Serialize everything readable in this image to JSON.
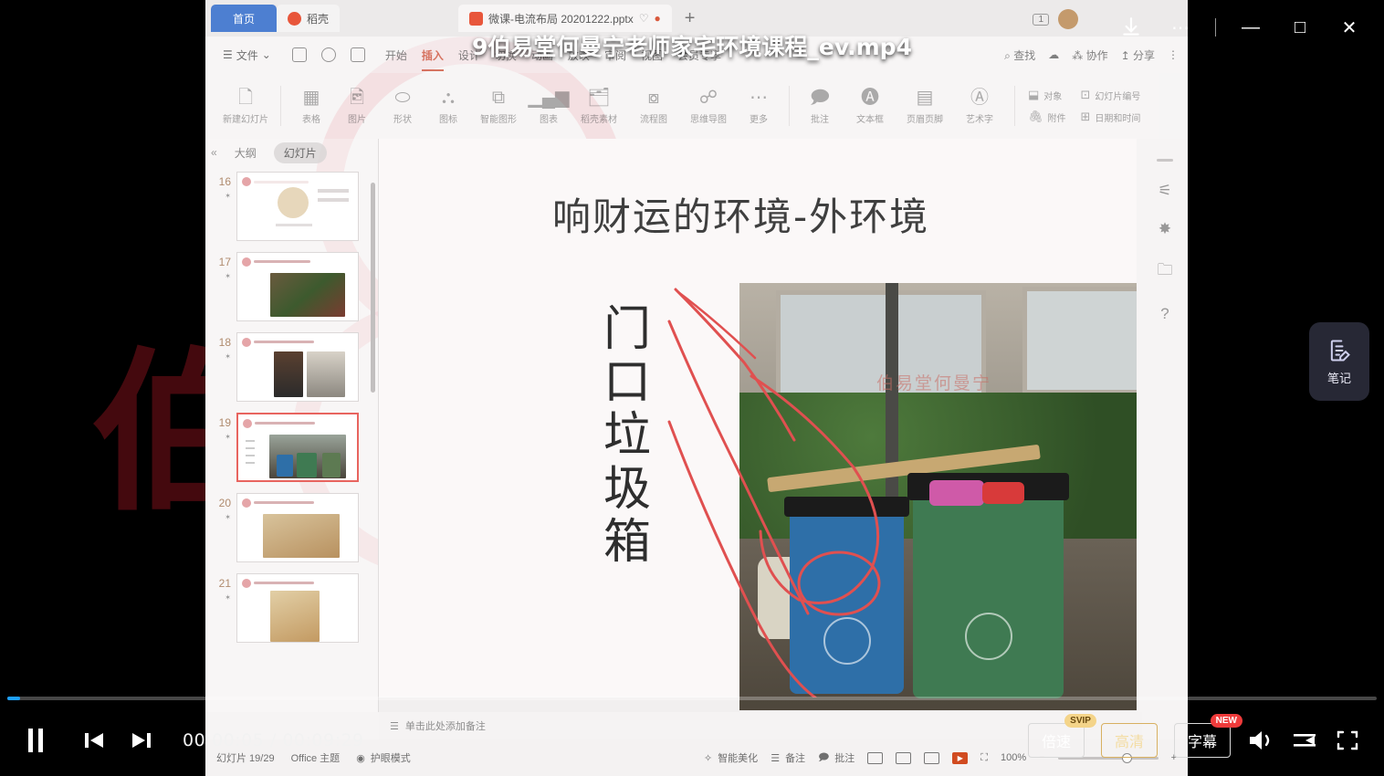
{
  "video": {
    "title": "9伯易堂何曼宁老师家宅环境课程_ev.mp4",
    "current_time": "00:00:05",
    "total_time": "00:09:29",
    "time_display": "00:00:05 / 00:09:29",
    "progress_percent": 0.9,
    "state": "playing"
  },
  "window_controls": {
    "download_icon": "download-icon",
    "more_icon": "more-horizontal-icon",
    "minimize": "—",
    "maximize": "□",
    "close": "✕"
  },
  "player_controls": {
    "pause": "pause-icon",
    "previous": "previous-icon",
    "next": "next-icon",
    "speed_label": "倍速",
    "speed_badge": "SVIP",
    "quality_label": "高清",
    "subtitle_label": "字幕",
    "subtitle_badge": "NEW",
    "volume_icon": "volume-icon",
    "playlist_icon": "playlist-icon",
    "fullscreen_icon": "fullscreen-icon"
  },
  "notes_fab": {
    "icon": "note-edit-icon",
    "label": "笔记"
  },
  "wps": {
    "tabs": [
      {
        "label": "首页",
        "icon": "home-icon",
        "active": false
      },
      {
        "label": "稻壳",
        "icon": "daoke-icon",
        "active": false
      },
      {
        "label": "微课-电流布局 20201222.pptx",
        "icon": "pptx-icon",
        "active": true
      }
    ],
    "new_tab": "+",
    "account_badge": "1",
    "menu": {
      "file_label": "文件",
      "file_chevron": "⌄",
      "quick_access": [
        "save-icon",
        "undo-icon",
        "print-icon"
      ],
      "ribbon_tabs": [
        "开始",
        "插入",
        "设计",
        "切换",
        "动画",
        "放映",
        "审阅",
        "视图",
        "会员专享"
      ],
      "ribbon_selected": "插入",
      "search_label": "查找",
      "cloud_icon": "cloud-icon",
      "collab_label": "协作",
      "share_label": "分享",
      "overflow": "⋮"
    },
    "ribbon": {
      "items": [
        {
          "label": "新建幻灯片",
          "icon": "new-slide-icon",
          "dropdown": true
        },
        {
          "label": "表格",
          "icon": "table-icon",
          "dropdown": true
        },
        {
          "label": "图片",
          "icon": "picture-icon",
          "dropdown": true
        },
        {
          "label": "形状",
          "icon": "shape-icon",
          "dropdown": true
        },
        {
          "label": "图标",
          "icon": "icon-library-icon",
          "dropdown": true
        },
        {
          "label": "智能图形",
          "icon": "smartart-icon",
          "dropdown": true
        },
        {
          "label": "图表",
          "icon": "chart-icon",
          "dropdown": true
        },
        {
          "label": "稻壳素材",
          "icon": "material-icon",
          "dropdown": false
        },
        {
          "label": "流程图",
          "icon": "flowchart-icon",
          "dropdown": true
        },
        {
          "label": "思维导图",
          "icon": "mindmap-icon",
          "dropdown": true
        },
        {
          "label": "更多",
          "icon": "more-icon",
          "dropdown": true
        },
        {
          "label": "批注",
          "icon": "comment-icon",
          "dropdown": false
        },
        {
          "label": "文本框",
          "icon": "textbox-icon",
          "dropdown": true
        },
        {
          "label": "页眉页脚",
          "icon": "header-footer-icon",
          "dropdown": false
        },
        {
          "label": "艺术字",
          "icon": "wordart-icon",
          "dropdown": true
        }
      ],
      "stacked": [
        {
          "label": "对象",
          "icon": "object-icon"
        },
        {
          "label": "附件",
          "icon": "attachment-icon"
        },
        {
          "label": "幻灯片编号",
          "icon": "slide-number-icon"
        },
        {
          "label": "日期和时间",
          "icon": "date-time-icon"
        }
      ]
    },
    "slide_panel": {
      "collapse_icon": "collapse-left-icon",
      "tabs": [
        {
          "label": "大纲",
          "selected": false
        },
        {
          "label": "幻灯片",
          "selected": true
        }
      ],
      "thumbnails": [
        {
          "number": "16",
          "selected": false
        },
        {
          "number": "17",
          "selected": false
        },
        {
          "number": "18",
          "selected": false
        },
        {
          "number": "19",
          "selected": true
        },
        {
          "number": "20",
          "selected": false
        },
        {
          "number": "21",
          "selected": false
        }
      ]
    },
    "slide": {
      "title": "响财运的环境-外环境",
      "vertical_text": "门口垃圾箱",
      "photo_watermark": "伯易堂何曼宁"
    },
    "right_rail": [
      {
        "icon": "grip-icon"
      },
      {
        "icon": "settings-sliders-icon"
      },
      {
        "icon": "animation-icon"
      },
      {
        "icon": "media-folder-icon"
      },
      {
        "icon": "help-icon"
      }
    ],
    "notes_placeholder": "单击此处添加备注",
    "status_bar": {
      "slide_counter": "幻灯片 19/29",
      "theme": "Office 主题",
      "eye_protect": "护眼模式",
      "spell_check": "智能美化",
      "accessibility": "备注",
      "selection": "批注",
      "views": [
        "normal-view-icon",
        "slide-sorter-icon",
        "reading-view-icon",
        "slideshow-icon"
      ],
      "zoom_level": "100%",
      "zoom_minus": "−",
      "zoom_plus": "+",
      "fit_icon": "fit-slide-icon"
    }
  }
}
